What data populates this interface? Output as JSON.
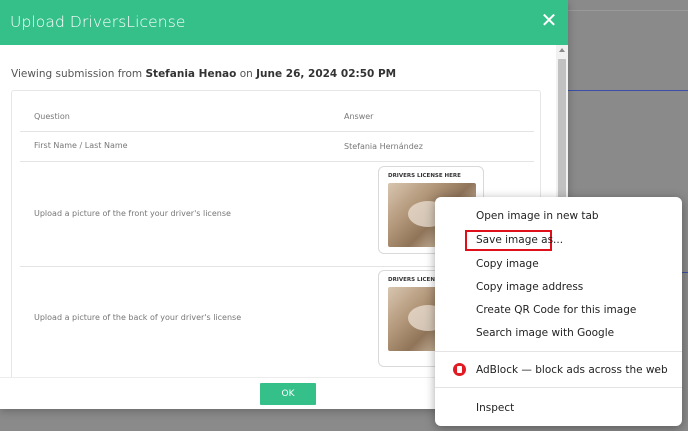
{
  "modal": {
    "title": "Upload DriversLicense",
    "close_glyph": "✕",
    "viewing_prefix": "Viewing submission from",
    "submitter": "Stefania Henao",
    "viewing_on": "on",
    "submitted_at": "June 26, 2024 02:50 PM",
    "table": {
      "headers": [
        "Question",
        "Answer"
      ],
      "rows": [
        {
          "question": "First Name / Last Name",
          "answer": "Stefania Hernández"
        },
        {
          "question": "Upload a picture of the front your driver's license",
          "image_caption": "DRIVERS LICENSE HERE"
        },
        {
          "question": "Upload a picture of the back of your driver's license",
          "image_caption": "DRIVERS LICENS"
        }
      ]
    },
    "ok_label": "OK",
    "accent": "#35c08a"
  },
  "context_menu": {
    "items": [
      {
        "label": "Open image in new tab"
      },
      {
        "label": "Save image as..."
      },
      {
        "label": "Copy image"
      },
      {
        "label": "Copy image address"
      },
      {
        "label": "Create QR Code for this image"
      },
      {
        "label": "Search image with Google"
      },
      {
        "label": "AdBlock — block ads across the web",
        "icon": "adblock-icon",
        "submenu": true
      },
      {
        "label": "Inspect"
      }
    ],
    "highlight_color": "#e0101a",
    "chevron": "›"
  }
}
